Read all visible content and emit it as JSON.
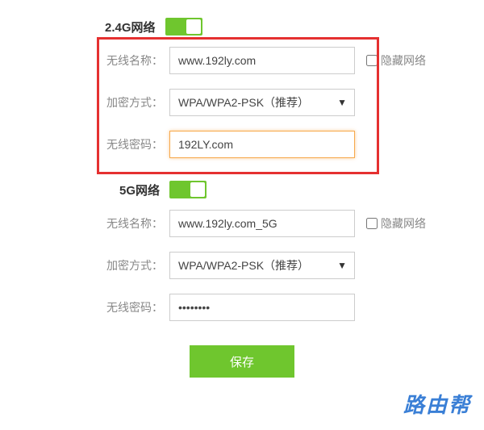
{
  "wifi24": {
    "title": "2.4G网络",
    "toggle": true,
    "ssid_label": "无线名称：",
    "ssid_value": "www.192ly.com",
    "hide_label": "隐藏网络",
    "enc_label": "加密方式：",
    "enc_value": "WPA/WPA2-PSK（推荐）",
    "pwd_label": "无线密码：",
    "pwd_value": "192LY.com"
  },
  "wifi5": {
    "title": "5G网络",
    "toggle": true,
    "ssid_label": "无线名称：",
    "ssid_value": "www.192ly.com_5G",
    "hide_label": "隐藏网络",
    "enc_label": "加密方式：",
    "enc_value": "WPA/WPA2-PSK（推荐）",
    "pwd_label": "无线密码：",
    "pwd_value": "••••••••"
  },
  "actions": {
    "save": "保存"
  },
  "watermark": "路由帮"
}
